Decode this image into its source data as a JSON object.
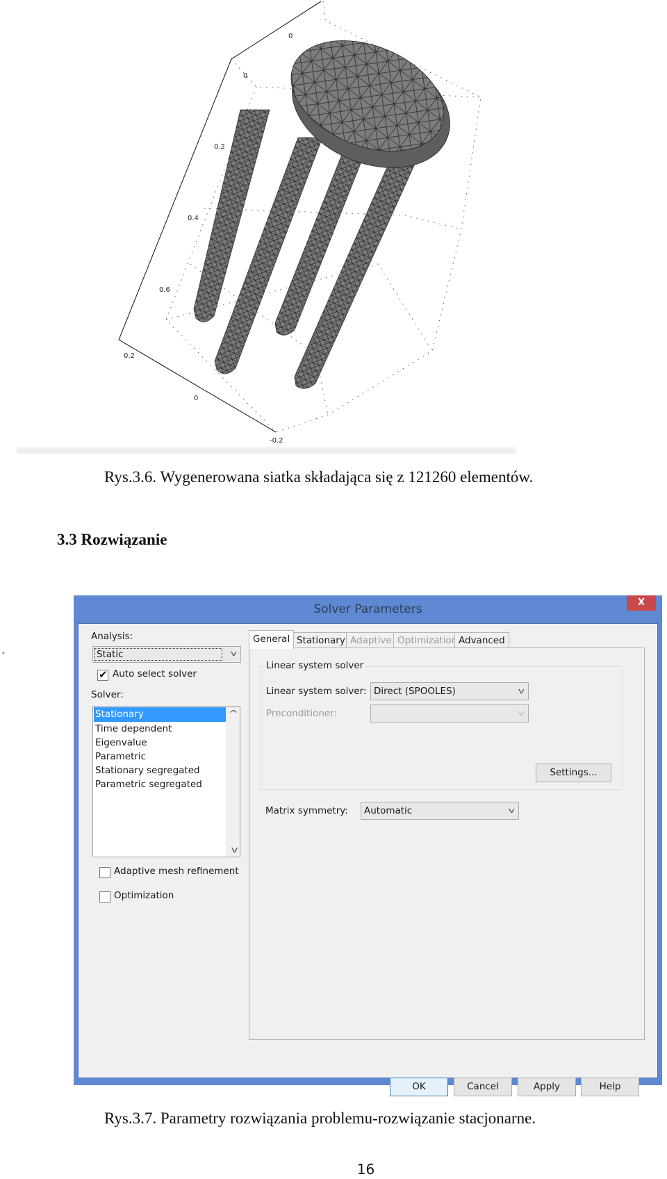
{
  "figure_1": {
    "axis_ticks": {
      "depth_axis": [
        "0"
      ],
      "vertical_axis": [
        "0",
        "0.2",
        "0.4",
        "0.6"
      ],
      "bottom_axis": [
        "0.2",
        "0",
        "-0.2"
      ]
    },
    "mesh_fill_color": "#7a7a7a",
    "caption": "Rys.3.6. Wygenerowana siatka składająca się z 121260 elementów."
  },
  "section": {
    "heading": "3.3 Rozwiązanie"
  },
  "stray_mark": "`",
  "dialog": {
    "title": "Solver Parameters",
    "close_label": "X",
    "title_bar_color": "#5e89d2",
    "close_color": "#c9494a",
    "analysis": {
      "label": "Analysis:",
      "value": "Static"
    },
    "auto_select_solver": {
      "label": "Auto select solver",
      "checked": true
    },
    "solver": {
      "label": "Solver:",
      "items": [
        {
          "label": "Stationary",
          "selected": true
        },
        {
          "label": "Time dependent",
          "selected": false
        },
        {
          "label": "Eigenvalue",
          "selected": false
        },
        {
          "label": "Parametric",
          "selected": false
        },
        {
          "label": "Stationary segregated",
          "selected": false
        },
        {
          "label": "Parametric segregated",
          "selected": false
        }
      ]
    },
    "adaptive_mesh_refinement": {
      "label": "Adaptive mesh refinement",
      "checked": false
    },
    "optimization": {
      "label": "Optimization",
      "checked": false
    },
    "tabs": [
      {
        "label": "General",
        "active": true,
        "enabled": true
      },
      {
        "label": "Stationary",
        "active": false,
        "enabled": true
      },
      {
        "label": "Adaptive",
        "active": false,
        "enabled": false
      },
      {
        "label": "Optimization",
        "active": false,
        "enabled": false
      },
      {
        "label": "Advanced",
        "active": false,
        "enabled": true
      }
    ],
    "general": {
      "group_title": "Linear system solver",
      "linear_system_solver": {
        "label": "Linear system solver:",
        "value": "Direct (SPOOLES)"
      },
      "preconditioner": {
        "label": "Preconditioner:",
        "value": "",
        "enabled": false
      },
      "settings_button": "Settings...",
      "matrix_symmetry": {
        "label": "Matrix symmetry:",
        "value": "Automatic"
      }
    },
    "buttons": {
      "ok": "OK",
      "cancel": "Cancel",
      "apply": "Apply",
      "help": "Help"
    },
    "caption": "Rys.3.7. Parametry rozwiązania problemu-rozwiązanie stacjonarne."
  },
  "page_number": "16"
}
